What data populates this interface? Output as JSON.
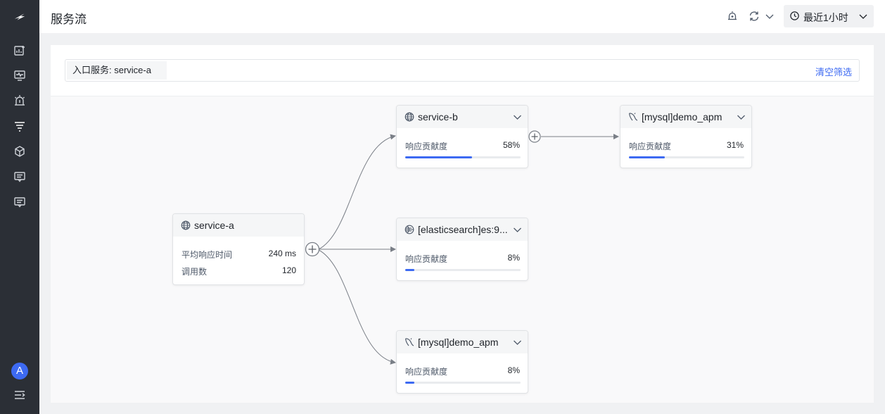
{
  "header": {
    "title": "服务流",
    "time_range": "最近1小时"
  },
  "filter": {
    "tag": "入口服务:  service-a",
    "clear_label": "清空筛选"
  },
  "user": {
    "avatar_initial": "A"
  },
  "sidebar": {
    "icons": [
      "logo-icon",
      "analysis-icon",
      "monitor-icon",
      "alert-icon",
      "filter-list-icon",
      "cube-icon",
      "log-icon",
      "message-icon"
    ]
  },
  "nodes": {
    "entry": {
      "title": "service-a",
      "icon": "globe-icon",
      "metrics": [
        {
          "label": "平均响应时间",
          "value": "240 ms"
        },
        {
          "label": "调用数",
          "value": "120"
        }
      ]
    },
    "service_b": {
      "title": "service-b",
      "icon": "globe-icon",
      "metric_label": "响应贡献度",
      "metric_value": "58%",
      "ratio": 0.58
    },
    "mysql_b": {
      "title": "[mysql]demo_apm",
      "icon": "mysql-icon",
      "metric_label": "响应贡献度",
      "metric_value": "31%",
      "ratio": 0.31
    },
    "elastic": {
      "title": "[elasticsearch]es:9...",
      "icon": "elasticsearch-icon",
      "metric_label": "响应贡献度",
      "metric_value": "8%",
      "ratio": 0.08
    },
    "mysql_a": {
      "title": "[mysql]demo_apm",
      "icon": "mysql-icon",
      "metric_label": "响应贡献度",
      "metric_value": "8%",
      "ratio": 0.08
    }
  },
  "colors": {
    "accent": "#3d6af2",
    "sidebar": "#2b2f36",
    "edge": "#7a7f87"
  }
}
